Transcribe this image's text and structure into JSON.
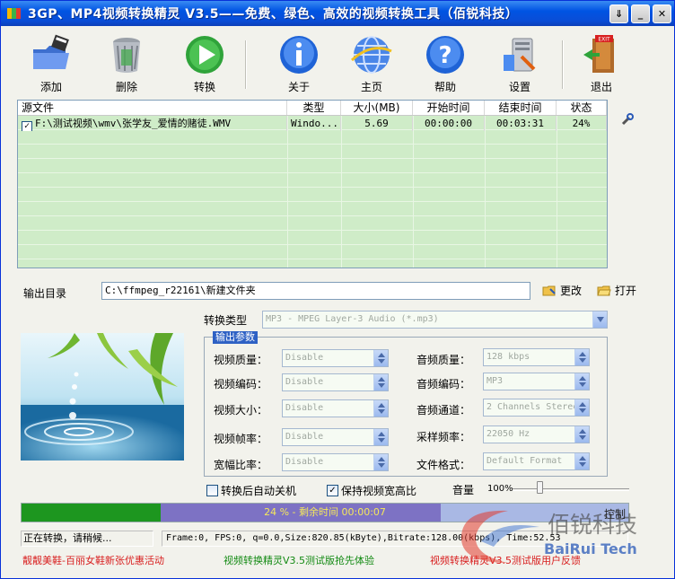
{
  "window": {
    "title": "3GP、MP4视频转换精灵 V3.5——免费、绿色、高效的视频转换工具（佰锐科技）"
  },
  "toolbar": [
    {
      "label": "添加",
      "icon": "add-folder-icon"
    },
    {
      "label": "删除",
      "icon": "trash-icon"
    },
    {
      "label": "转换",
      "icon": "play-icon"
    },
    {
      "label": "关于",
      "icon": "info-icon"
    },
    {
      "label": "主页",
      "icon": "globe-icon"
    },
    {
      "label": "帮助",
      "icon": "help-icon"
    },
    {
      "label": "设置",
      "icon": "settings-icon"
    },
    {
      "label": "退出",
      "icon": "exit-door-icon"
    }
  ],
  "filelist": {
    "columns": [
      "源文件",
      "类型",
      "大小(MB)",
      "开始时间",
      "结束时间",
      "状态"
    ],
    "rows": [
      {
        "checked": true,
        "file": "F:\\测试视频\\wmv\\张学友_爱情的赌徒.WMV",
        "type": "Windo...",
        "size": "5.69",
        "start": "00:00:00",
        "end": "00:03:31",
        "status": "24%"
      }
    ]
  },
  "output": {
    "label": "输出目录",
    "path": "C:\\ffmpeg_r22161\\新建文件夹",
    "change_label": "更改",
    "open_label": "打开"
  },
  "convert": {
    "type_label": "转换类型",
    "type_value": "MP3 - MPEG Layer-3 Audio (*.mp3)",
    "params_legend": "输出参数"
  },
  "params": {
    "video": [
      {
        "label": "视频质量：",
        "value": "Disable"
      },
      {
        "label": "视频编码：",
        "value": "Disable"
      },
      {
        "label": "视频大小：",
        "value": "Disable"
      },
      {
        "label": "视频帧率：",
        "value": "Disable"
      },
      {
        "label": "宽幅比率：",
        "value": "Disable"
      }
    ],
    "audio": [
      {
        "label": "音频质量：",
        "value": "128 kbps"
      },
      {
        "label": "音频编码：",
        "value": "MP3"
      },
      {
        "label": "音频通道：",
        "value": "2 Channels Stereo"
      },
      {
        "label": "采样频率：",
        "value": "22050 Hz"
      },
      {
        "label": "文件格式：",
        "value": "Default Format"
      }
    ]
  },
  "options": {
    "auto_shutdown": {
      "label": "转换后自动关机",
      "checked": false
    },
    "keep_ratio": {
      "label": "保持视频宽高比",
      "checked": true
    },
    "volume_label": "音量",
    "volume_value": "100%",
    "volume_level": 0.2
  },
  "progress": {
    "percent": 24,
    "text": "24 % - 剩余时间 00:00:07"
  },
  "status": {
    "left": "正在转换，请稍候...",
    "right": "Frame:0, FPS:0, q=0.0,Size:820.85(kByte),Bitrate:128.00(kbps), Time:52.53"
  },
  "footer": {
    "link1": "靓靓美鞋-百丽女鞋新张优惠活动",
    "link2": "视频转换精灵V3.5测试版抢先体验",
    "link3": "视频转换精灵V3.5测试版用户反馈"
  },
  "watermark": {
    "cn": "佰锐科技",
    "en": "BaiRui Tech",
    "ctrl": "控制"
  },
  "colors": {
    "title_bar": "#0054e3",
    "list_bg": "#cfecc8",
    "progress_fill": "#1d961f",
    "progress_text": "#f5e85a",
    "footer_red": "#d81e1e",
    "footer_green": "#138a13"
  }
}
